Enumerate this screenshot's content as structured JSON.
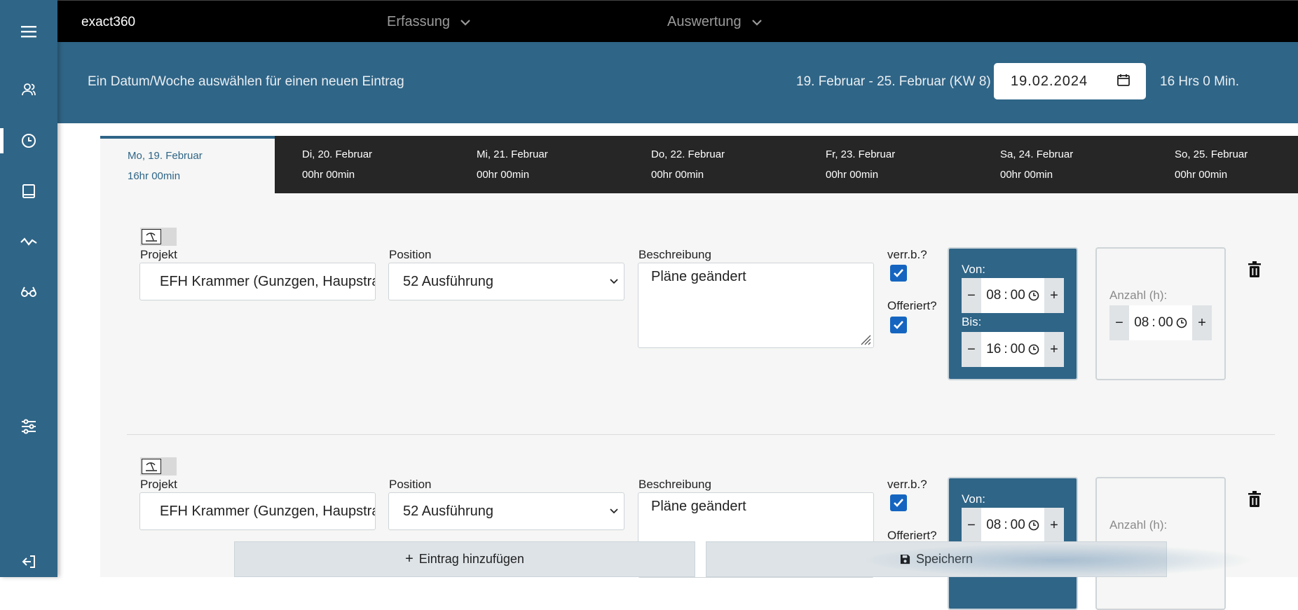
{
  "app": {
    "brand": "exact360"
  },
  "topmenu": [
    {
      "label": "Erfassung"
    },
    {
      "label": "Auswertung"
    }
  ],
  "header": {
    "prompt": "Ein Datum/Woche auswählen für einen neuen Eintrag",
    "week_range": "19. Februar - 25. Februar (KW 8)",
    "date_value": "19.02.2024",
    "total": "16 Hrs 0 Min."
  },
  "sidebar": {
    "items": [
      {
        "icon": "menu-icon"
      },
      {
        "icon": "users-icon"
      },
      {
        "icon": "clock-icon",
        "active": true
      },
      {
        "icon": "book-icon"
      },
      {
        "icon": "activity-icon"
      },
      {
        "icon": "glasses-icon"
      },
      {
        "icon": "sliders-icon"
      },
      {
        "icon": "logout-icon"
      }
    ]
  },
  "days": [
    {
      "day": "Mo, 19. Februar",
      "hours": "16hr 00min",
      "active": true
    },
    {
      "day": "Di, 20. Februar",
      "hours": "00hr 00min"
    },
    {
      "day": "Mi, 21. Februar",
      "hours": "00hr 00min"
    },
    {
      "day": "Do, 22. Februar",
      "hours": "00hr 00min"
    },
    {
      "day": "Fr, 23. Februar",
      "hours": "00hr 00min"
    },
    {
      "day": "Sa, 24. Februar",
      "hours": "00hr 00min"
    },
    {
      "day": "So, 25. Februar",
      "hours": "00hr 00min"
    }
  ],
  "labels": {
    "projekt": "Projekt",
    "position": "Position",
    "beschreibung": "Beschreibung",
    "verrechenbar": "verr.b.?",
    "offeriert": "Offeriert?",
    "von": "Von:",
    "bis": "Bis:",
    "anzahl": "Anzahl (h):"
  },
  "entries": [
    {
      "projekt": "EFH Krammer (Gunzgen, Haupstrasse)",
      "position": "52 Ausführung",
      "beschreibung": "Pläne geändert",
      "verrechenbar": true,
      "offeriert": true,
      "von_h": "08",
      "von_m": "00",
      "bis_h": "16",
      "bis_m": "00",
      "anzahl_h": "08",
      "anzahl_m": "00"
    },
    {
      "projekt": "EFH Krammer (Gunzgen, Haupstrasse)",
      "position": "52 Ausführung",
      "beschreibung": "Pläne geändert",
      "verrechenbar": true,
      "offeriert": true,
      "von_h": "08",
      "von_m": "00"
    }
  ],
  "actions": {
    "add": "Eintrag hinzufügen",
    "save": "Speichern"
  }
}
